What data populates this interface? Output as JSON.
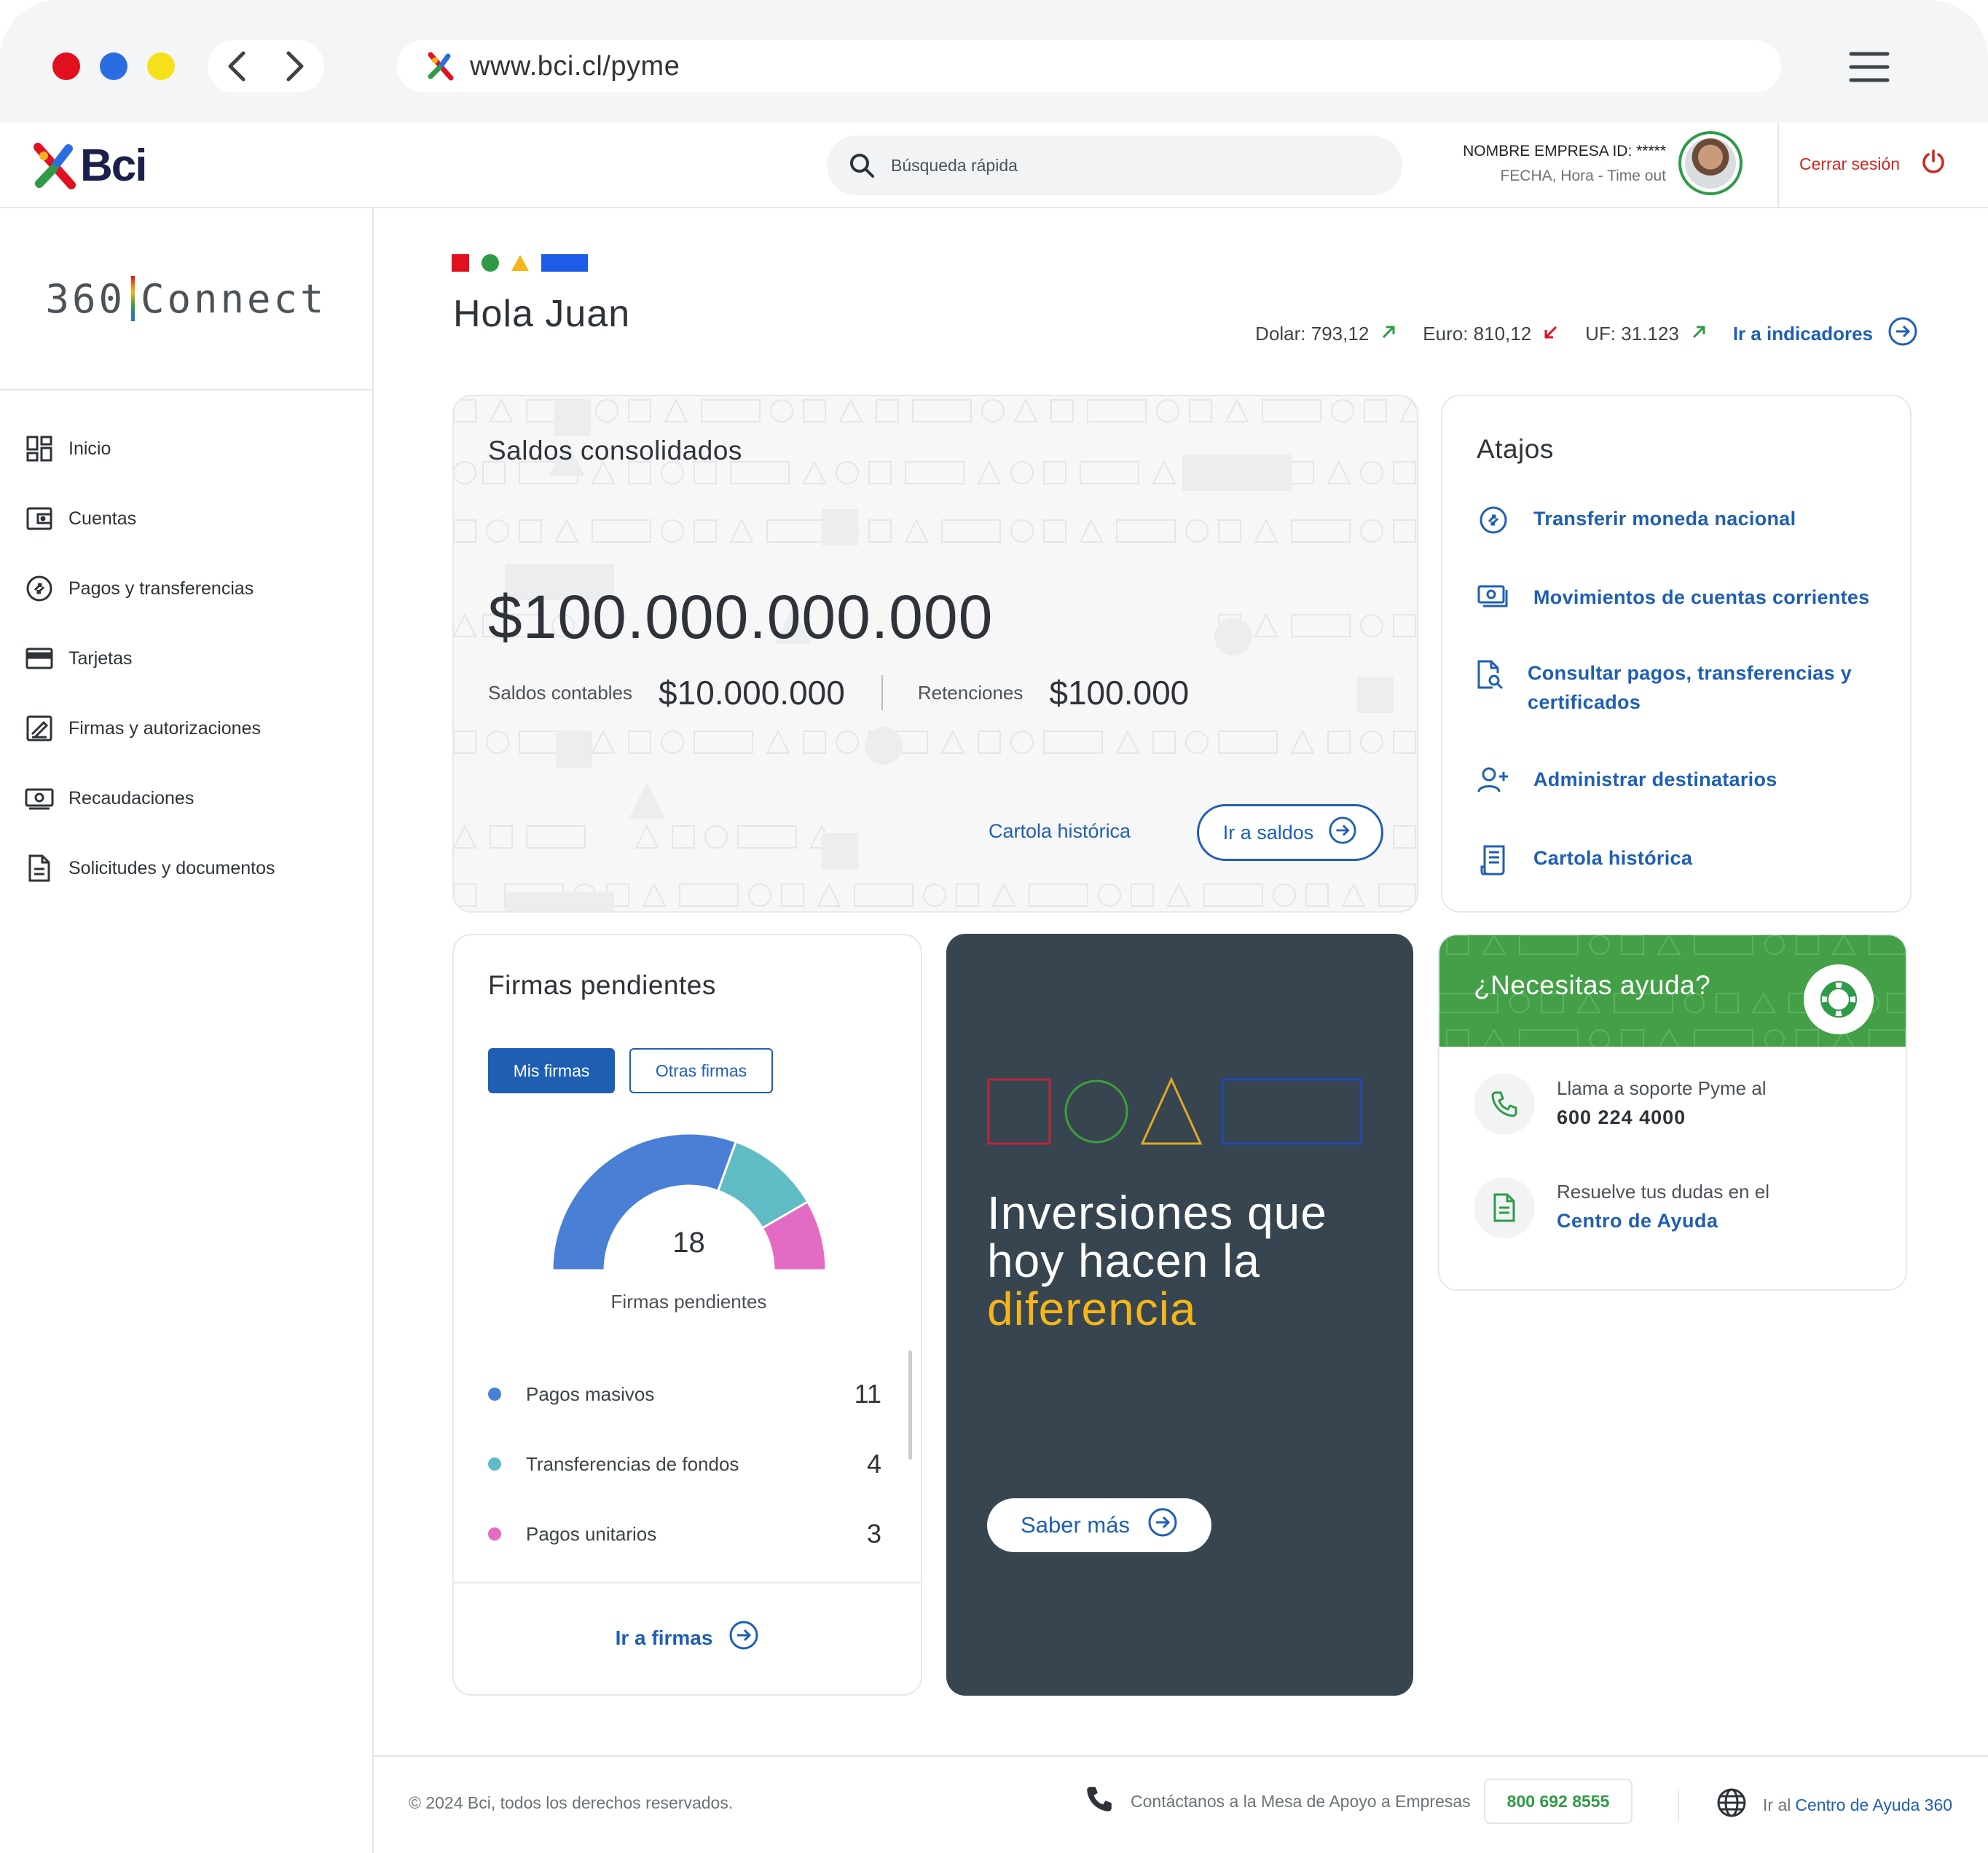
{
  "browser": {
    "url": "www.bci.cl/pyme"
  },
  "topbar": {
    "logo": "Bci",
    "search_placeholder": "Búsqueda rápida",
    "company_name": "NOMBRE EMPRESA ID: *****",
    "company_meta": "FECHA, Hora - Time out",
    "logout_label": "Cerrar sesión"
  },
  "sidebar": {
    "brand_left": "360",
    "brand_right": "Connect",
    "items": [
      {
        "label": "Inicio",
        "icon": "dashboard-icon"
      },
      {
        "label": "Cuentas",
        "icon": "wallet-icon"
      },
      {
        "label": "Pagos y transferencias",
        "icon": "transfer-icon"
      },
      {
        "label": "Tarjetas",
        "icon": "card-icon"
      },
      {
        "label": "Firmas y autorizaciones",
        "icon": "signature-icon"
      },
      {
        "label": "Recaudaciones",
        "icon": "money-icon"
      },
      {
        "label": "Solicitudes y documentos",
        "icon": "document-icon"
      }
    ]
  },
  "header": {
    "greeting": "Hola Juan",
    "indicators": [
      {
        "label": "Dolar: 793,12",
        "trend": "up"
      },
      {
        "label": "Euro: 810,12",
        "trend": "down"
      },
      {
        "label": "UF: 31.123",
        "trend": "up"
      }
    ],
    "indicators_link": "Ir a indicadores"
  },
  "saldos": {
    "title": "Saldos consolidados",
    "total": "$100.000.000.000",
    "contables_label": "Saldos contables",
    "contables_value": "$10.000.000",
    "retenciones_label": "Retenciones",
    "retenciones_value": "$100.000",
    "link": "Cartola histórica",
    "button": "Ir a saldos"
  },
  "atajos": {
    "title": "Atajos",
    "items": [
      {
        "label": "Transferir moneda nacional",
        "icon": "transfer-icon"
      },
      {
        "label": "Movimientos de cuentas corrientes",
        "icon": "cash-icon"
      },
      {
        "label": "Consultar pagos, transferencias y certificados",
        "icon": "search-document-icon"
      },
      {
        "label": "Administrar destinatarios",
        "icon": "add-user-icon"
      },
      {
        "label": "Cartola histórica",
        "icon": "receipt-icon"
      }
    ]
  },
  "firmas": {
    "title": "Firmas pendientes",
    "tab_active": "Mis firmas",
    "tab_inactive": "Otras firmas",
    "total": "18",
    "total_label": "Firmas pendientes",
    "items": [
      {
        "label": "Pagos masivos",
        "count": "11",
        "color": "#4a7fd6"
      },
      {
        "label": "Transferencias de fondos",
        "count": "4",
        "color": "#5fbcc4"
      },
      {
        "label": "Pagos unitarios",
        "count": "3",
        "color": "#e36bc3"
      }
    ],
    "footer_link": "Ir a firmas"
  },
  "promo": {
    "line1": "Inversiones que",
    "line2": "hoy hacen la",
    "highlight": "diferencia",
    "button": "Saber más"
  },
  "ayuda": {
    "title": "¿Necesitas ayuda?",
    "phone_text": "Llama a soporte Pyme al",
    "phone_number": "600 224 4000",
    "center_text": "Resuelve tus dudas en el",
    "center_link": "Centro de Ayuda"
  },
  "footer": {
    "copyright": "© 2024 Bci, todos los derechos reservados.",
    "contact_text": "Contáctanos a la Mesa de Apoyo a Empresas",
    "contact_phone": "800 692 8555",
    "help_prefix": "Ir al",
    "help_link": "Centro de Ayuda 360"
  },
  "colors": {
    "primary": "#1f5fb3",
    "brand_red": "#e1101e",
    "brand_green": "#2f9b47",
    "brand_yellow": "#f5b51b",
    "brand_blue": "#1e5be6",
    "promo_bg": "#36454f",
    "help_green": "#43a047"
  }
}
